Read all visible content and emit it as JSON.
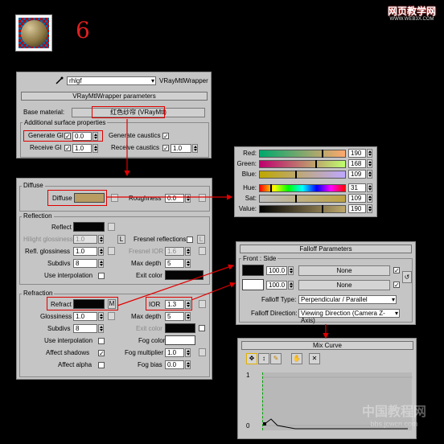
{
  "step_number": "6",
  "watermark_top": {
    "title": "网页教学网",
    "url": "WWW.WEB3X.COM"
  },
  "watermark_bottom": {
    "title": "中国教程网",
    "url": "bbs.jcwcn.com"
  },
  "colors": {
    "annotation_red": "#e00000",
    "diffuse_swatch": "#b89c62",
    "dark_swatch": "#050505"
  },
  "material": {
    "name": "rhlgf",
    "type_button": "VRayMtlWrapper",
    "rollout_title": "VRayMtlWrapper parameters",
    "base_material_label": "Base material:",
    "base_material_value": "红色纱帘 (VRayMtl)",
    "surface_props_label": "Additional surface properties",
    "generate_gi_label": "Generate GI",
    "generate_gi_value": "0.0",
    "generate_caustics_label": "Generate caustics",
    "receive_gi_label": "Receive GI",
    "receive_gi_value": "1.0",
    "receive_caustics_label": "Receive caustics",
    "receive_caustics_value": "1.0"
  },
  "basic": {
    "diffuse_group": "Diffuse",
    "diffuse_label": "Diffuse",
    "roughness_label": "Roughness",
    "roughness_value": "0.0",
    "reflection_group": "Reflection",
    "reflect_label": "Reflect",
    "hilight_label": "Hilight glossiness",
    "hilight_value": "1.0",
    "lock_label": "L",
    "fresnel_label": "Fresnel reflections",
    "refl_gloss_label": "Refl. glossiness",
    "refl_gloss_value": "1.0",
    "fresnel_ior_label": "Fresnel IOR",
    "fresnel_ior_value": "1.6",
    "subdivs_label": "Subdivs",
    "subdivs_value": "8",
    "max_depth_label": "Max depth",
    "max_depth_value": "5",
    "use_interp_label": "Use interpolation",
    "exit_color_label": "Exit color",
    "refraction_group": "Refraction",
    "refract_label": "Refract",
    "map_m": "M",
    "ior_label": "IOR",
    "ior_value": "1.3",
    "glossiness_label": "Glossiness",
    "glossiness_value": "1.0",
    "r_max_depth_value": "5",
    "r_subdivs_value": "8",
    "r_exit_color_label": "Exit color",
    "r_use_interp_label": "Use interpolation",
    "fog_color_label": "Fog color",
    "affect_shadows_label": "Affect shadows",
    "fog_mult_label": "Fog multiplier",
    "fog_mult_value": "1.0",
    "affect_alpha_label": "Affect alpha",
    "fog_bias_label": "Fog bias",
    "fog_bias_value": "0.0"
  },
  "color_picker": {
    "rows": [
      {
        "label": "Red:",
        "value": "190",
        "fraction": 0.745
      },
      {
        "label": "Green:",
        "value": "168",
        "fraction": 0.659
      },
      {
        "label": "Blue:",
        "value": "109",
        "fraction": 0.427
      },
      {
        "label": "Hue:",
        "value": "31",
        "fraction": 0.122
      },
      {
        "label": "Sat:",
        "value": "109",
        "fraction": 0.427
      },
      {
        "label": "Value:",
        "value": "190",
        "fraction": 0.745
      }
    ]
  },
  "falloff": {
    "title": "Falloff Parameters",
    "group_label": "Front : Side",
    "row1_value": "100.0",
    "row1_map": "None",
    "row2_value": "100.0",
    "row2_map": "None",
    "type_label": "Falloff Type:",
    "type_value": "Perpendicular / Parallel",
    "direction_label": "Falloff Direction:",
    "direction_value": "Viewing Direction (Camera Z-Axis)"
  },
  "mix_curve": {
    "title": "Mix Curve",
    "y_top": "1",
    "y_bottom": "0"
  }
}
